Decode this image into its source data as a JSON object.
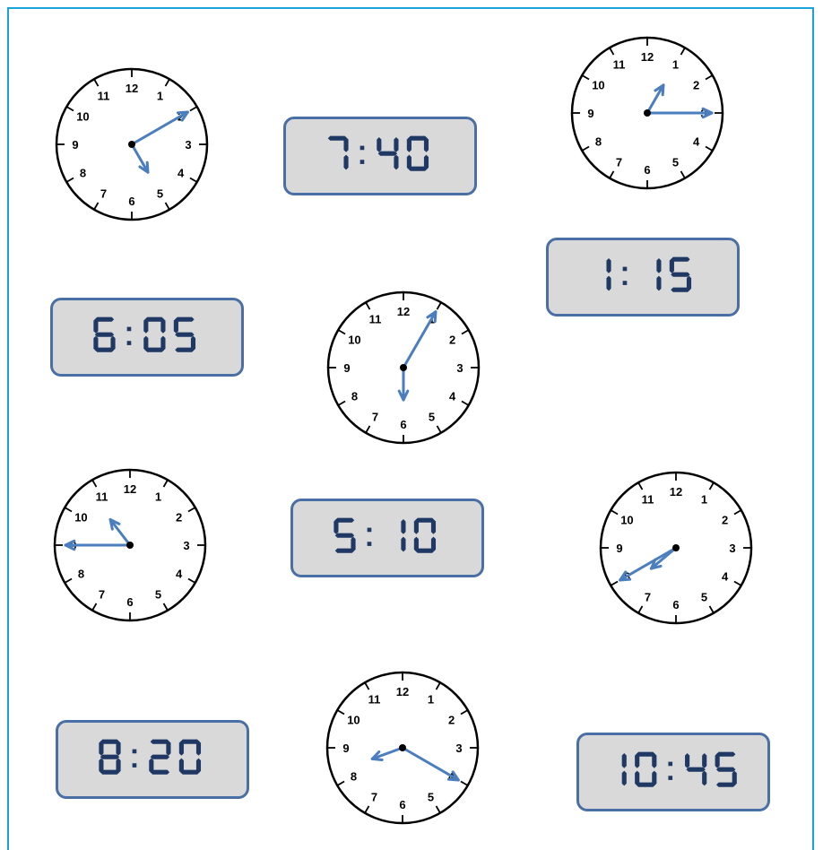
{
  "worksheet": {
    "accent_color": "#1aa3db",
    "hand_color": "#4a7ebf",
    "display_fill": "#d9d9d9",
    "display_border": "#4a6fa5",
    "digit_color": "#1f3864"
  },
  "clocks": [
    {
      "id": "a",
      "numbers": [
        "12",
        "1",
        "2",
        "3",
        "4",
        "5",
        "6",
        "7",
        "8",
        "9",
        "10",
        "11"
      ],
      "hour_hand_points_to": 5,
      "minute_hand_points_to": 2,
      "shown_time": "5:10"
    },
    {
      "id": "b",
      "numbers": [
        "12",
        "1",
        "2",
        "3",
        "4",
        "5",
        "6",
        "7",
        "8",
        "9",
        "10",
        "11"
      ],
      "hour_hand_points_to": 1,
      "minute_hand_points_to": 3,
      "shown_time": "1:15"
    },
    {
      "id": "c",
      "numbers": [
        "12",
        "1",
        "2",
        "3",
        "4",
        "5",
        "6",
        "7",
        "8",
        "9",
        "10",
        "11"
      ],
      "hour_hand_points_to": 6,
      "minute_hand_points_to": 1,
      "shown_time": "6:05"
    },
    {
      "id": "d",
      "numbers": [
        "12",
        "1",
        "2",
        "3",
        "4",
        "5",
        "6",
        "7",
        "8",
        "9",
        "10",
        "11"
      ],
      "hour_hand_points_to": 10.75,
      "minute_hand_points_to": 9,
      "shown_time": "10:45"
    },
    {
      "id": "e",
      "numbers": [
        "12",
        "1",
        "2",
        "3",
        "4",
        "5",
        "6",
        "7",
        "8",
        "9",
        "10",
        "11"
      ],
      "hour_hand_points_to": 7.67,
      "minute_hand_points_to": 8,
      "shown_time": "7:40"
    },
    {
      "id": "f",
      "numbers": [
        "12",
        "1",
        "2",
        "3",
        "4",
        "5",
        "6",
        "7",
        "8",
        "9",
        "10",
        "11"
      ],
      "hour_hand_points_to": 8.33,
      "minute_hand_points_to": 4,
      "shown_time": "8:20"
    }
  ],
  "digital_displays": [
    {
      "id": "d1",
      "time": "7:40"
    },
    {
      "id": "d2",
      "time": "1:15"
    },
    {
      "id": "d3",
      "time": "6:05"
    },
    {
      "id": "d4",
      "time": "5:10"
    },
    {
      "id": "d5",
      "time": "8:20"
    },
    {
      "id": "d6",
      "time": "10:45"
    }
  ]
}
